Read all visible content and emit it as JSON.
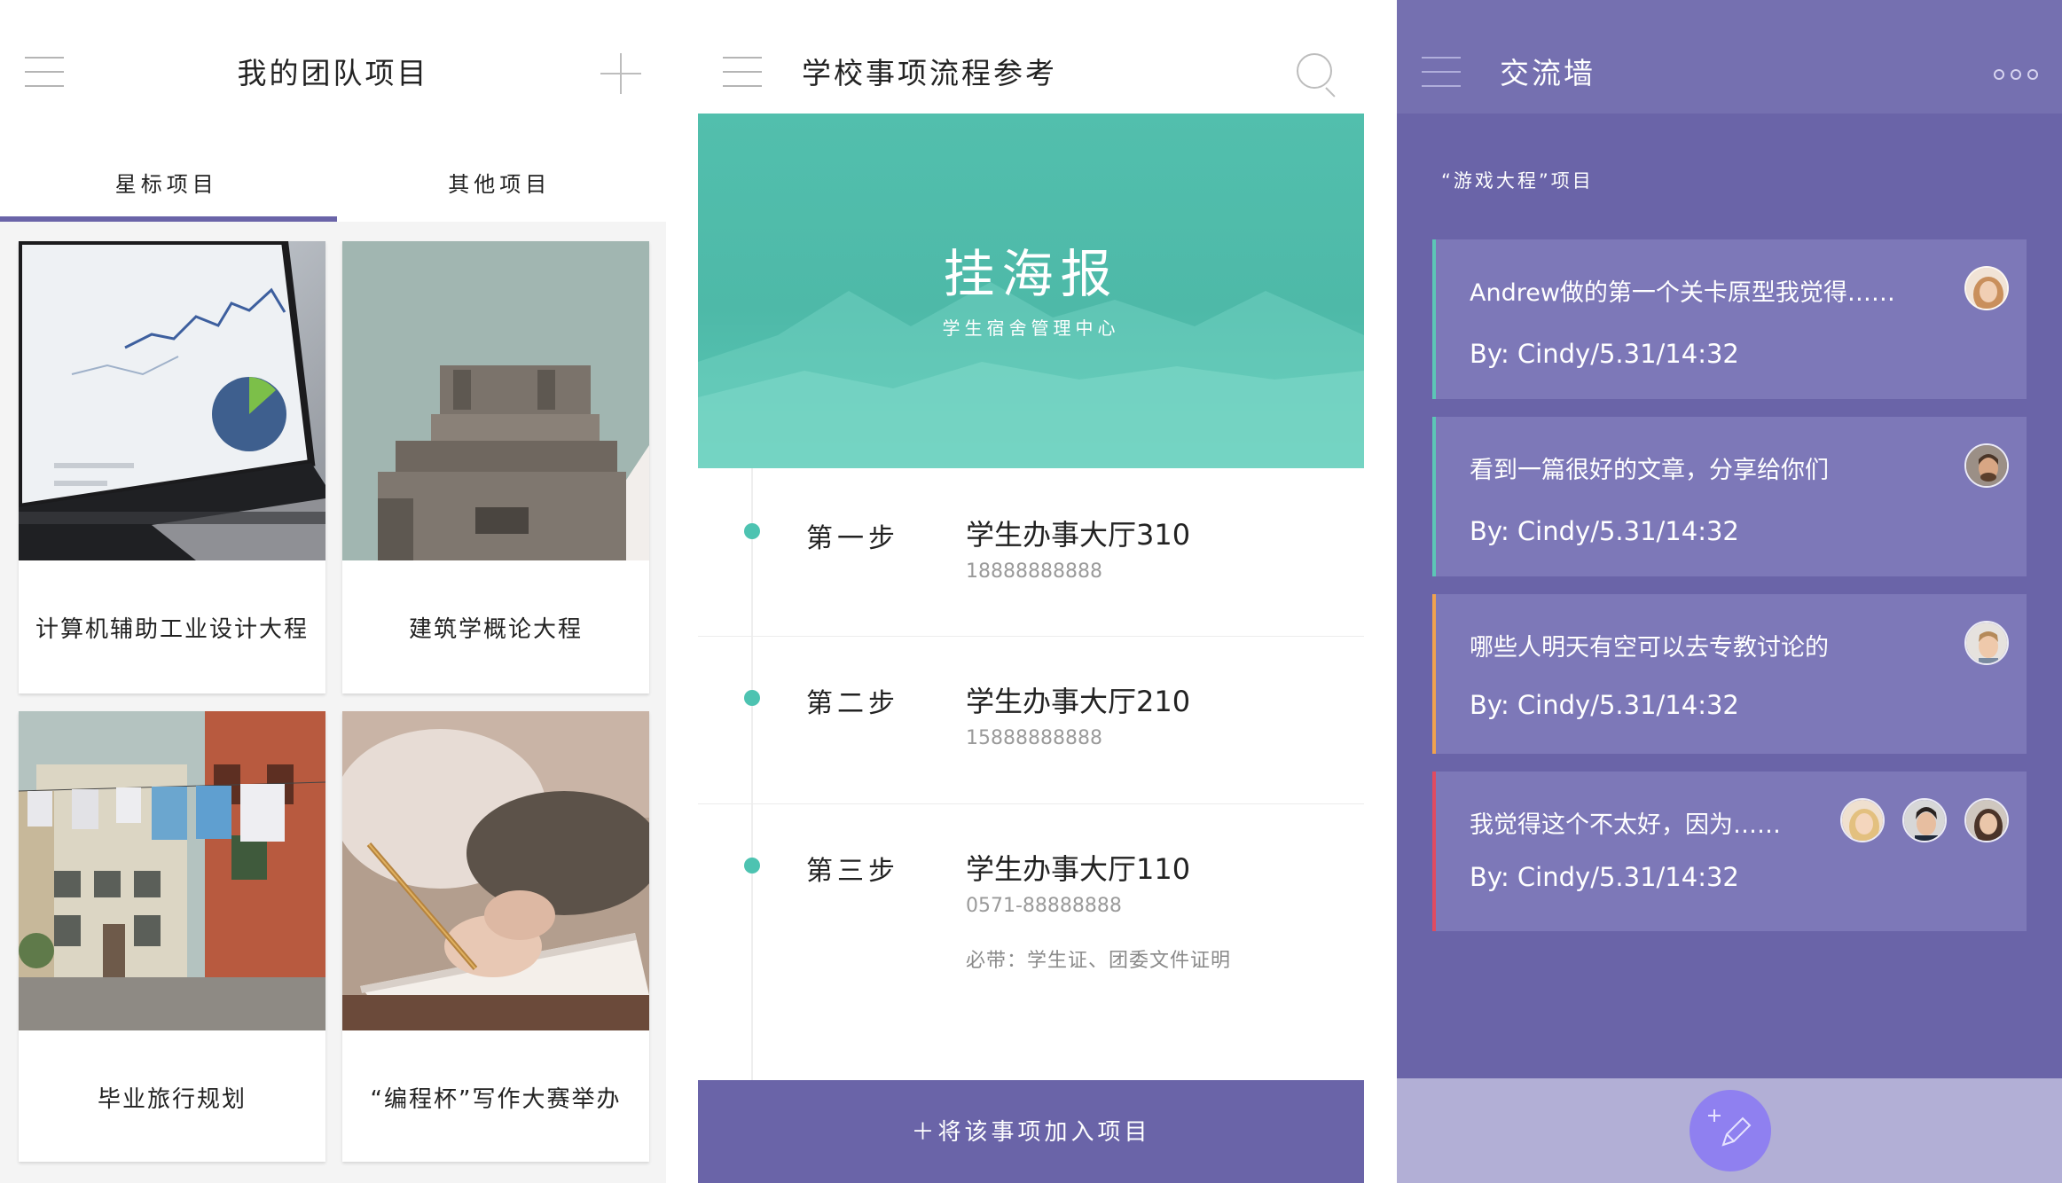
{
  "projects_screen": {
    "title": "我的团队项目",
    "menu_icon": "hamburger-menu-icon",
    "add_icon": "plus-icon",
    "tabs": [
      {
        "label": "星标项目",
        "active": true
      },
      {
        "label": "其他项目",
        "active": false
      }
    ],
    "accent_color": "#6a64a8",
    "cards": [
      {
        "label": "计算机辅助工业设计大程",
        "image": "laptop-analytics-photo"
      },
      {
        "label": "建筑学概论大程",
        "image": "concrete-building-photo"
      },
      {
        "label": "毕业旅行规划",
        "image": "venice-street-photo"
      },
      {
        "label": "“编程杯”写作大赛举办",
        "image": "writing-notebook-photo"
      }
    ]
  },
  "process_screen": {
    "title": "学校事项流程参考",
    "search_icon": "search-icon",
    "poster": {
      "title": "挂海报",
      "subtitle": "学生宿舍管理中心",
      "color": "#52bfad"
    },
    "steps": [
      {
        "name": "第一步",
        "place": "学生办事大厅310",
        "phone": "18888888888"
      },
      {
        "name": "第二步",
        "place": "学生办事大厅210",
        "phone": "15888888888"
      },
      {
        "name": "第三步",
        "place": "学生办事大厅110",
        "phone": "0571-88888888",
        "note": "必带：学生证、团委文件证明"
      }
    ],
    "add_button": "＋将该事项加入项目"
  },
  "wall_screen": {
    "title": "交流墙",
    "more_icon": "more-dots-icon",
    "subtitle": "“游戏大程”项目",
    "background_color": "#6a64a8",
    "posts": [
      {
        "message": "Andrew做的第一个关卡原型我觉得……",
        "by": "By: Cindy/5.31/14:32",
        "accent": "#5cc6b6",
        "avatars": 1
      },
      {
        "message": "看到一篇很好的文章，分享给你们",
        "by": "By: Cindy/5.31/14:32",
        "accent": "#5cc6b6",
        "avatars": 1
      },
      {
        "message": "哪些人明天有空可以去专教讨论的",
        "by": "By: Cindy/5.31/14:32",
        "accent": "#f0a24e",
        "avatars": 1
      },
      {
        "message": "我觉得这个不太好，因为……",
        "by": "By: Cindy/5.31/14:32",
        "accent": "#e14b60",
        "avatars": 3
      }
    ],
    "compose_icon": "compose-pencil-icon"
  }
}
